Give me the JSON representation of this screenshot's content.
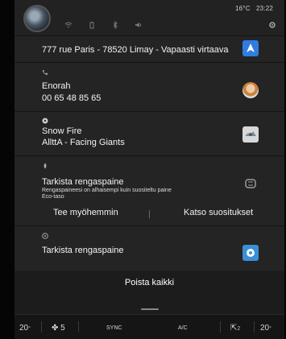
{
  "status": {
    "temperature": "16°C",
    "time": "23:22"
  },
  "cards": {
    "navigation": {
      "text": "777 rue Paris - 78520 Limay - Vapaasti virtaava"
    },
    "call": {
      "name": "Enorah",
      "number": "00 65 48 85 65"
    },
    "media": {
      "title": "Snow Fire",
      "subtitle": "AllttA - Facing Giants"
    },
    "tyre_alert": {
      "title": "Tarkista rengaspaine",
      "detail": "Rengaspaineesi on alhaisempi kuin suositeltu paine",
      "mode": "Eco-taso",
      "later_label": "Tee myöhemmin",
      "recommend_label": "Katso suositukset"
    },
    "tyre_alert_2": {
      "title": "Tarkista rengaspaine"
    }
  },
  "clear_all_label": "Poista kaikki",
  "climate": {
    "left_temp": "20",
    "left_fan": "5",
    "sync_label": "SYNC",
    "ac_label": "A/C",
    "fan_right_value": "2",
    "right_temp": "20"
  },
  "colors": {
    "accent": "#2f7de1",
    "background": "#1c1c1c",
    "card": "#242424"
  }
}
